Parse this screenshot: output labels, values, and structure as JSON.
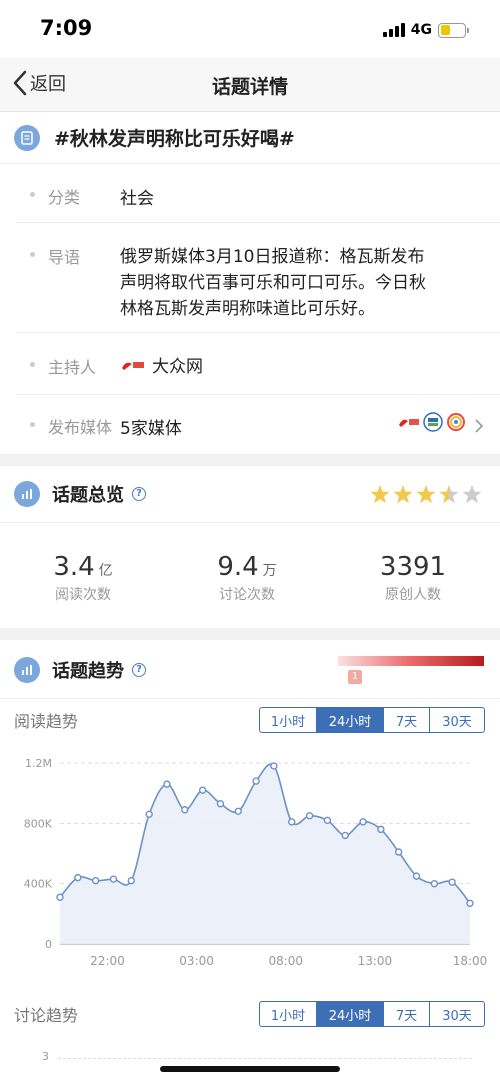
{
  "status_bar": {
    "time": "7:09",
    "network": "4G"
  },
  "nav": {
    "back_label": "返回",
    "title": "话题详情"
  },
  "topic": {
    "title": "#秋林发声明称比可乐好喝#"
  },
  "info": {
    "category_label": "分类",
    "category_value": "社会",
    "intro_label": "导语",
    "intro_lines": [
      "俄罗斯媒体3月10日报道称：格瓦斯发布",
      "声明将取代百事可乐和可口可乐。今日秋",
      "林格瓦斯发声明称味道比可乐好。"
    ],
    "host_label": "主持人",
    "host_value": "大众网",
    "media_label": "发布媒体",
    "media_value": "5家媒体"
  },
  "overview": {
    "title": "话题总览",
    "rating": 3.5,
    "stats": [
      {
        "num": "3.4",
        "unit": "亿",
        "label": "阅读次数"
      },
      {
        "num": "9.4",
        "unit": "万",
        "label": "讨论次数"
      },
      {
        "num": "3391",
        "unit": "",
        "label": "原创人数"
      }
    ]
  },
  "trend": {
    "title": "话题趋势",
    "heat_marker": "1",
    "reading_label": "阅读趋势",
    "discussion_label": "讨论趋势",
    "ranges": [
      "1小时",
      "24小时",
      "7天",
      "30天"
    ],
    "active_range": "24小时",
    "discussion_y_first_tick": "3"
  },
  "colors": {
    "accent": "#3d6fb6",
    "line": "#6c91c9",
    "area": "#e9eef8",
    "star": "#f2c94c"
  },
  "chart_data": {
    "type": "area",
    "title": "",
    "xlabel": "",
    "ylabel": "",
    "ylim": [
      0,
      1200000
    ],
    "yticks": [
      "0",
      "400K",
      "800K",
      "1.2M"
    ],
    "xticks": [
      "22:00",
      "03:00",
      "08:00",
      "13:00",
      "18:00"
    ],
    "x": [
      0,
      1,
      2,
      3,
      4,
      5,
      6,
      7,
      8,
      9,
      10,
      11,
      12,
      13,
      14,
      15,
      16,
      17,
      18,
      19,
      20,
      21,
      22,
      23
    ],
    "series": [
      {
        "values": [
          310000,
          440000,
          420000,
          430000,
          420000,
          860000,
          1060000,
          890000,
          1020000,
          930000,
          880000,
          1080000,
          1180000,
          810000,
          850000,
          820000,
          720000,
          810000,
          760000,
          610000,
          450000,
          400000,
          410000,
          270000
        ]
      }
    ]
  }
}
